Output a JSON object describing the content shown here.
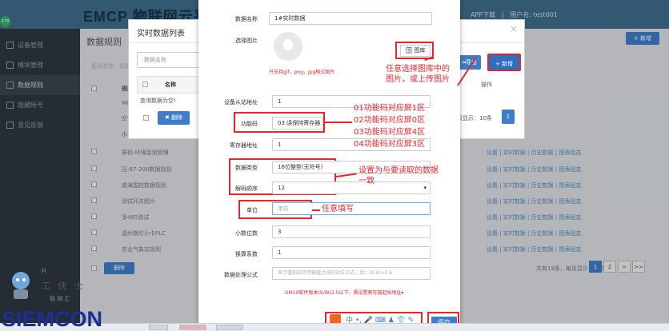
{
  "app": {
    "logo": "EMCP",
    "logo_suffix": "物联网云平台",
    "download": "APP下载",
    "user": "用户名: test001"
  },
  "avatar": "178",
  "sidebar": {
    "items": [
      {
        "label": "设备管理"
      },
      {
        "label": "模块管理"
      },
      {
        "label": "数据规则"
      },
      {
        "label": "隐藏帐号"
      },
      {
        "label": "意见反馈"
      }
    ]
  },
  "content": {
    "title": "数据规则",
    "add_label": "+ 新增",
    "search_placeholder": "规则名称、规则编号",
    "col_name": "规则",
    "col_op": "操作",
    "rows": [
      {
        "name": "MC"
      },
      {
        "name": "空气"
      },
      {
        "name": "水位"
      },
      {
        "name": "屏柜-环境监测管理"
      },
      {
        "name": "压-67-200数据规则"
      },
      {
        "name": "威海国控数据规则"
      },
      {
        "name": "测试开关图片"
      },
      {
        "name": "多485测试"
      },
      {
        "name": "温州南珍小卡PLC"
      },
      {
        "name": "农业气象站规则"
      }
    ],
    "row_ops": "设置 | 实时数据 | 历史数据 | 图表组态",
    "del_label": "删除",
    "page_info": "共有19条，每页显示：10条",
    "pages": [
      "1",
      "2",
      ">",
      ">>"
    ]
  },
  "modal": {
    "title": "实时数据列表",
    "close": "×",
    "search_placeholder": "数据名称",
    "col_name": "名称",
    "empty": "查询数据为空!",
    "del_label": "删除",
    "export_label": "导出",
    "add_label": "+ 新增",
    "op_header": "操作",
    "page_info": "页显示：10条",
    "page_btn": "1"
  },
  "form": {
    "name_label": "数据名称",
    "name_value": "1#实时数据",
    "img_label": "选择图片",
    "img_hint": "只支持gif，png，jpg格式图片",
    "lib_label": "图库",
    "slave_label": "设备从站地址",
    "slave_value": "1",
    "func_label": "功能码",
    "func_value": "03:读保持寄存器",
    "reg_label": "寄存器地址",
    "reg_value": "1",
    "dtype_label": "数据类型",
    "dtype_value": "16位整型(无符号)",
    "order_label": "解码顺序",
    "order_value": "12",
    "unit_label": "单位",
    "unit_placeholder": "单位",
    "dec_label": "小数位数",
    "dec_value": "3",
    "coef_label": "换算系数",
    "coef_value": "1",
    "formula_label": "数据处理公式",
    "formula_placeholder": "显示值和实际传输值之间的对应公式，如：(X-4)×0.5",
    "version_note": "GM10软件版本(S/W)2.5以下，需设置寄存器起始地址",
    "save_label": "保存"
  },
  "annotations": {
    "image_note": "任意选择图库中的\n图片，或上传图片",
    "func_notes": [
      "01功能码对应屏1区",
      "02功能码对应屏0区",
      "03功能码对应屏4区",
      "04功能码对应屏3区"
    ],
    "type_note": "设置为与要读取的数据\n一致",
    "unit_note": "任意填写"
  },
  "watermark": {
    "brand": "SIEMCON",
    "cn": "工 侠 士",
    "sub": "智 网 汇",
    "top": "料"
  },
  "colors": {
    "red": "#e3272d",
    "blue": "#3d7dca",
    "sidebar": "#2f3640",
    "topbar": "#3f6c8b"
  }
}
